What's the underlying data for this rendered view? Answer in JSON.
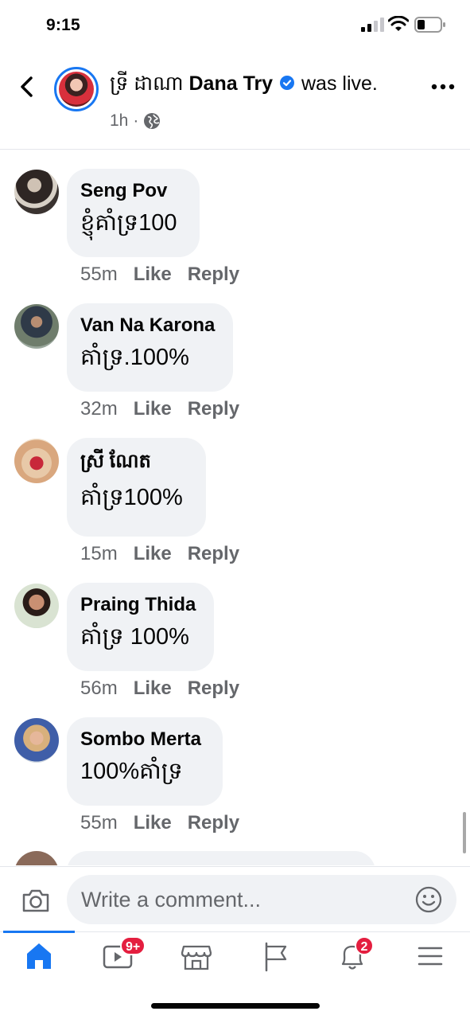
{
  "status": {
    "time": "9:15"
  },
  "header": {
    "name_khmer": "ទ្រី ដាណា",
    "name": "Dana Try",
    "action": "was live.",
    "time": "1h",
    "separator": "·"
  },
  "comments": [
    {
      "name": "Seng Pov",
      "text": "ខ្ញុំគាំទ្រ100",
      "time": "55m",
      "like": "Like",
      "reply": "Reply"
    },
    {
      "name": "Van Na Karona",
      "text": " គាំទ្រ.100%",
      "time": "32m",
      "like": "Like",
      "reply": "Reply"
    },
    {
      "name": "ស្រី ណែត",
      "text": "គាំទ្រ100%",
      "time": "15m",
      "like": "Like",
      "reply": "Reply"
    },
    {
      "name": "Praing Thida",
      "text": "គាំទ្រ 100%",
      "time": "56m",
      "like": "Like",
      "reply": "Reply"
    },
    {
      "name": "Sombo Merta",
      "text": "100%គាំទ្រ",
      "time": "55m",
      "like": "Like",
      "reply": "Reply"
    }
  ],
  "composer": {
    "placeholder": "Write a comment..."
  },
  "tabbar": {
    "video_badge": "9+",
    "notifications_badge": "2"
  },
  "colors": {
    "accent": "#1877f2",
    "bubble": "#f0f2f5",
    "badge": "#e41e3f"
  }
}
